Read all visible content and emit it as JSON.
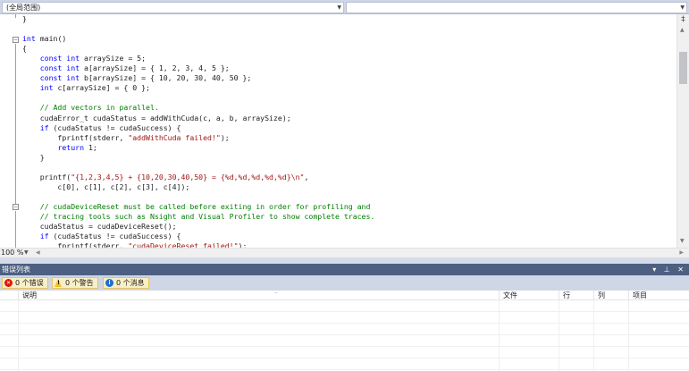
{
  "navbar": {
    "scope_dropdown": "(全局范围)",
    "member_dropdown": ""
  },
  "editor": {
    "code_lines": [
      {
        "segments": [
          {
            "cls": "tx",
            "text": "}"
          }
        ]
      },
      {
        "segments": []
      },
      {
        "segments": [
          {
            "cls": "kw",
            "text": "int"
          },
          {
            "cls": "tx",
            "text": " main()"
          }
        ]
      },
      {
        "segments": [
          {
            "cls": "tx",
            "text": "{"
          }
        ]
      },
      {
        "segments": [
          {
            "cls": "tx",
            "text": "    "
          },
          {
            "cls": "kw",
            "text": "const int"
          },
          {
            "cls": "tx",
            "text": " arraySize = 5;"
          }
        ]
      },
      {
        "segments": [
          {
            "cls": "tx",
            "text": "    "
          },
          {
            "cls": "kw",
            "text": "const int"
          },
          {
            "cls": "tx",
            "text": " a[arraySize] = { 1, 2, 3, 4, 5 };"
          }
        ]
      },
      {
        "segments": [
          {
            "cls": "tx",
            "text": "    "
          },
          {
            "cls": "kw",
            "text": "const int"
          },
          {
            "cls": "tx",
            "text": " b[arraySize] = { 10, 20, 30, 40, 50 };"
          }
        ]
      },
      {
        "segments": [
          {
            "cls": "tx",
            "text": "    "
          },
          {
            "cls": "kw",
            "text": "int"
          },
          {
            "cls": "tx",
            "text": " c[arraySize] = { 0 };"
          }
        ]
      },
      {
        "segments": []
      },
      {
        "segments": [
          {
            "cls": "tx",
            "text": "    "
          },
          {
            "cls": "cm",
            "text": "// Add vectors in parallel."
          }
        ]
      },
      {
        "segments": [
          {
            "cls": "tx",
            "text": "    cudaError_t cudaStatus = addWithCuda(c, a, b, arraySize);"
          }
        ]
      },
      {
        "segments": [
          {
            "cls": "tx",
            "text": "    "
          },
          {
            "cls": "kw",
            "text": "if"
          },
          {
            "cls": "tx",
            "text": " (cudaStatus != cudaSuccess) {"
          }
        ]
      },
      {
        "segments": [
          {
            "cls": "tx",
            "text": "        fprintf(stderr, "
          },
          {
            "cls": "st",
            "text": "\"addWithCuda failed!\""
          },
          {
            "cls": "tx",
            "text": ");"
          }
        ]
      },
      {
        "segments": [
          {
            "cls": "tx",
            "text": "        "
          },
          {
            "cls": "kw",
            "text": "return"
          },
          {
            "cls": "tx",
            "text": " 1;"
          }
        ]
      },
      {
        "segments": [
          {
            "cls": "tx",
            "text": "    }"
          }
        ]
      },
      {
        "segments": []
      },
      {
        "segments": [
          {
            "cls": "tx",
            "text": "    printf("
          },
          {
            "cls": "st",
            "text": "\"{1,2,3,4,5} + {10,20,30,40,50} = {%d,%d,%d,%d,%d}\\n\""
          },
          {
            "cls": "tx",
            "text": ","
          }
        ]
      },
      {
        "segments": [
          {
            "cls": "tx",
            "text": "        c[0], c[1], c[2], c[3], c[4]);"
          }
        ]
      },
      {
        "segments": []
      },
      {
        "segments": [
          {
            "cls": "tx",
            "text": "    "
          },
          {
            "cls": "cm",
            "text": "// cudaDeviceReset must be called before exiting in order for profiling and"
          }
        ]
      },
      {
        "segments": [
          {
            "cls": "tx",
            "text": "    "
          },
          {
            "cls": "cm",
            "text": "// tracing tools such as Nsight and Visual Profiler to show complete traces."
          }
        ]
      },
      {
        "segments": [
          {
            "cls": "tx",
            "text": "    cudaStatus = cudaDeviceReset();"
          }
        ]
      },
      {
        "segments": [
          {
            "cls": "tx",
            "text": "    "
          },
          {
            "cls": "kw",
            "text": "if"
          },
          {
            "cls": "tx",
            "text": " (cudaStatus != cudaSuccess) {"
          }
        ]
      },
      {
        "segments": [
          {
            "cls": "tx",
            "text": "        fprintf(stderr, "
          },
          {
            "cls": "st",
            "text": "\"cudaDeviceReset failed!\""
          },
          {
            "cls": "tx",
            "text": ");"
          }
        ]
      }
    ]
  },
  "status": {
    "zoom": "100 %"
  },
  "error_list": {
    "title": "错误列表",
    "controls": "▾ ⊥ ✕",
    "filters": {
      "errors": "0 个错误",
      "warnings": "0 个警告",
      "messages": "0 个消息"
    },
    "columns": {
      "description": "说明",
      "file": "文件",
      "line": "行",
      "column": "列",
      "project": "项目"
    }
  }
}
